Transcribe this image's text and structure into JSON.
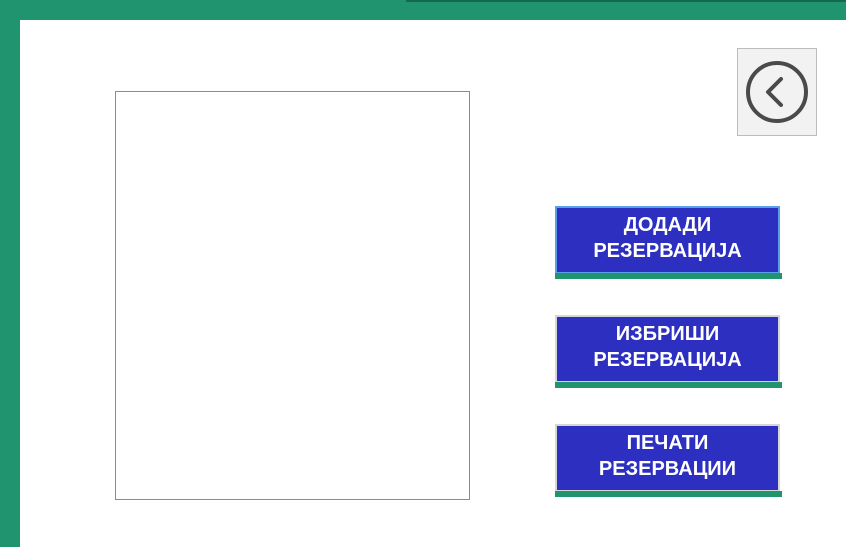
{
  "buttons": {
    "add": {
      "line1": "ДОДАДИ",
      "line2": "РЕЗЕРВАЦИЈА"
    },
    "delete": {
      "line1": "ИЗБРИШИ",
      "line2": "РЕЗЕРВАЦИЈА"
    },
    "print": {
      "line1": "ПЕЧАТИ",
      "line2": "РЕЗЕРВАЦИИ"
    }
  },
  "icons": {
    "back": "chevron-left-circle-icon"
  },
  "colors": {
    "frame": "#1f946f",
    "button_fill": "#2c2fc0",
    "button_text": "#ffffff"
  }
}
